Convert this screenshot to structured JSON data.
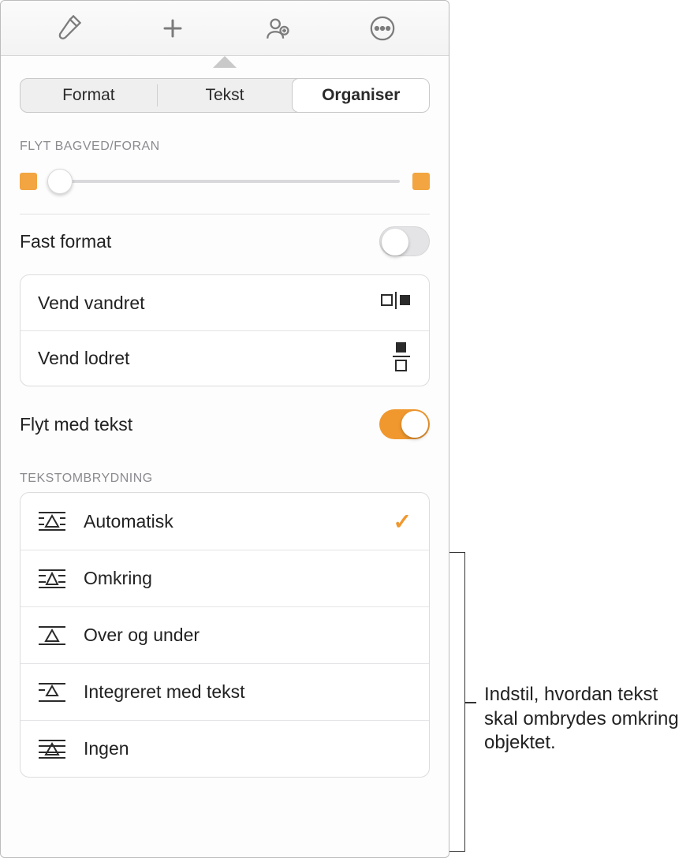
{
  "toolbar": {
    "icons": [
      "brush-icon",
      "plus-icon",
      "collaborate-icon",
      "more-icon"
    ]
  },
  "tabs": {
    "items": [
      "Format",
      "Tekst",
      "Organiser"
    ],
    "active_index": 2
  },
  "section_move": {
    "label": "FLYT BAGVED/FORAN"
  },
  "fixed_format": {
    "label": "Fast format",
    "enabled": false
  },
  "flip": {
    "horizontal": "Vend vandret",
    "vertical": "Vend lodret"
  },
  "move_with_text": {
    "label": "Flyt med tekst",
    "enabled": true
  },
  "text_wrap": {
    "label": "TEKSTOMBRYDNING",
    "options": [
      {
        "label": "Automatisk",
        "selected": true
      },
      {
        "label": "Omkring",
        "selected": false
      },
      {
        "label": "Over og under",
        "selected": false
      },
      {
        "label": "Integreret med tekst",
        "selected": false
      },
      {
        "label": "Ingen",
        "selected": false
      }
    ]
  },
  "callout": {
    "text": "Indstil, hvordan tekst skal ombrydes omkring objektet."
  },
  "colors": {
    "accent": "#f0982e",
    "accent_light": "#f2a540"
  }
}
